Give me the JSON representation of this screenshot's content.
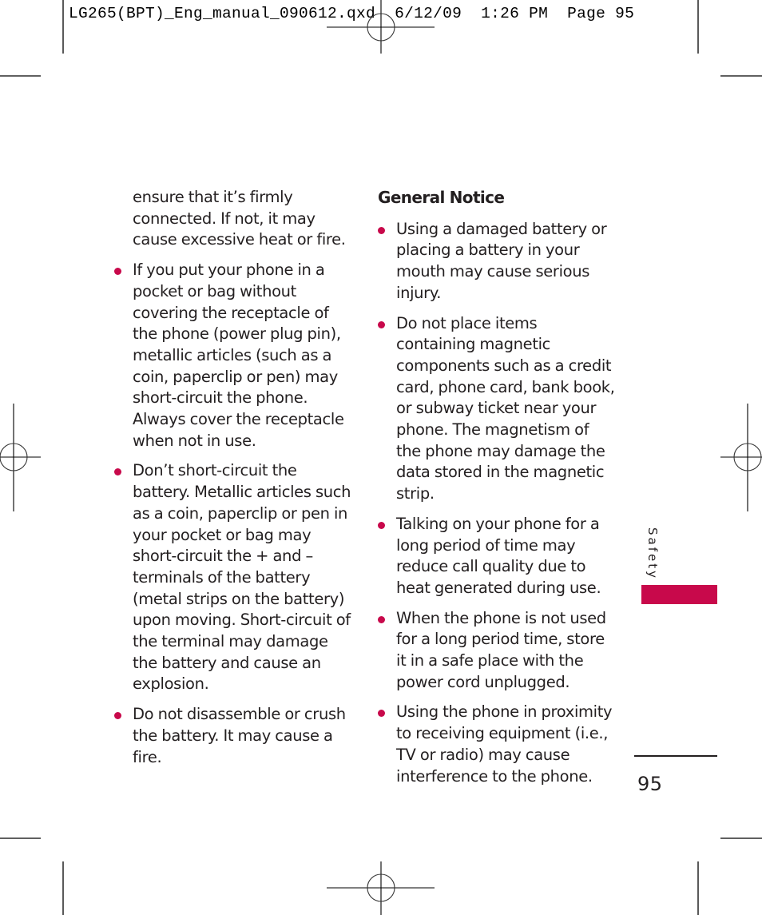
{
  "slug_line": {
    "filename": "LG265(BPT)_Eng_manual_090612.qxd",
    "date": "6/12/09",
    "time": "1:26 PM",
    "page_label": "Page 95"
  },
  "left_column": {
    "continuation": "ensure that it’s firmly connected. If not, it may cause excessive heat or fire.",
    "bullets": [
      "If you put your phone in a pocket or bag without covering the receptacle of the phone (power plug pin), metallic articles (such as a coin, paperclip or pen) may short-circuit the phone. Always cover the receptacle when not in use.",
      "Don’t short-circuit the battery. Metallic articles such as a coin, paperclip or pen in your pocket or bag may short-circuit the + and – terminals of the battery (metal strips on the battery) upon moving. Short-circuit of the terminal may damage the battery and cause an explosion.",
      "Do not disassemble or crush the battery. It may cause a fire."
    ]
  },
  "right_column": {
    "heading": "General Notice",
    "bullets": [
      "Using a damaged battery or placing a battery in your mouth may cause serious injury.",
      "Do not place items containing magnetic components such as a credit card, phone card, bank book, or subway ticket near your phone. The magnetism of the phone may damage the data stored in the magnetic strip.",
      "Talking on your phone for a long period of time may reduce call quality due to heat generated during use.",
      "When the phone is not used for a long period time, store it in a safe place with the power cord unplugged.",
      "Using the phone in proximity to receiving equipment (i.e., TV or radio) may cause interference to the phone."
    ]
  },
  "side_tab": {
    "label": "Safety",
    "accent_color": "#c8094b"
  },
  "page_number": "95"
}
